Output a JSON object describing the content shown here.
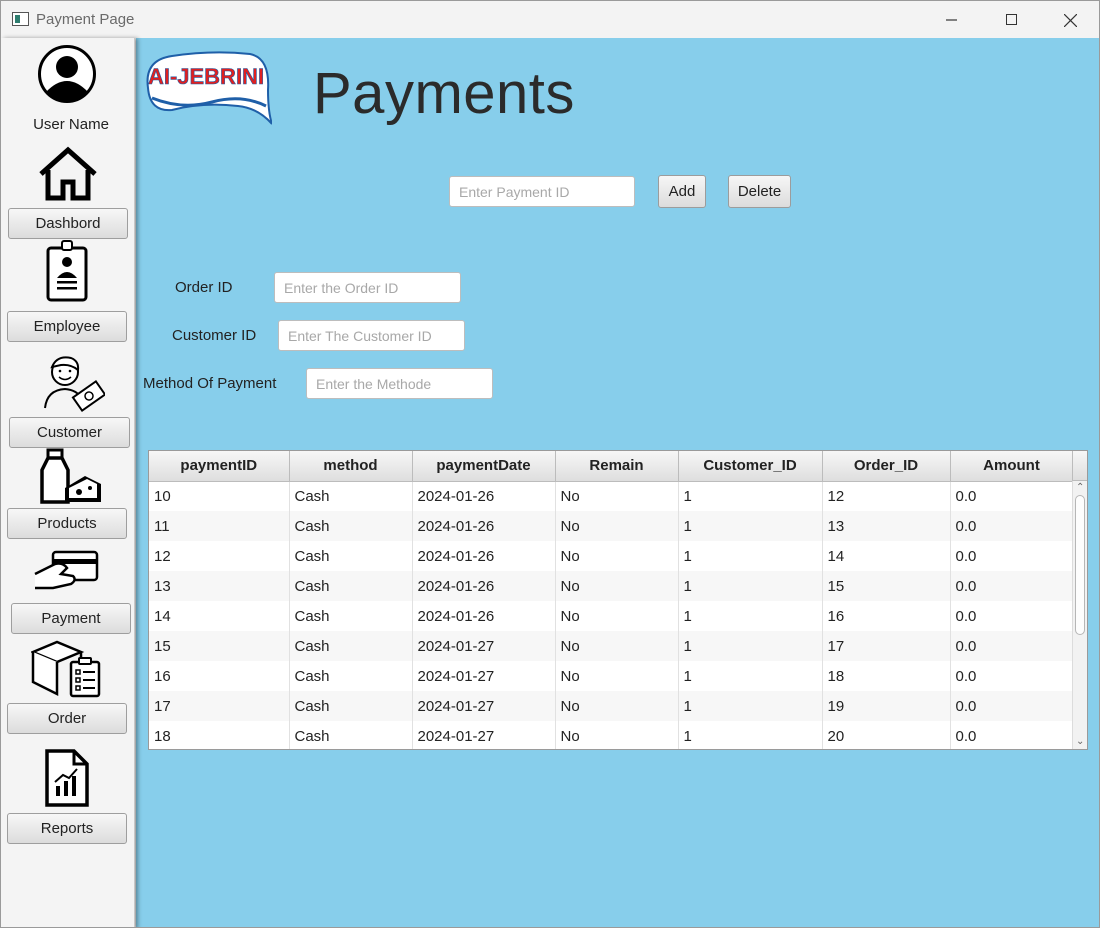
{
  "window": {
    "title": "Payment Page"
  },
  "sidebar": {
    "user_name": "User Name",
    "items": [
      {
        "label": "Dashbord",
        "icon": "home-icon"
      },
      {
        "label": "Employee",
        "icon": "employee-badge-icon"
      },
      {
        "label": "Customer",
        "icon": "customer-with-cash-icon"
      },
      {
        "label": "Products",
        "icon": "milk-and-cheese-icon"
      },
      {
        "label": "Payment",
        "icon": "card-payment-icon"
      },
      {
        "label": "Order",
        "icon": "box-checklist-icon"
      },
      {
        "label": "Reports",
        "icon": "report-chart-icon"
      }
    ]
  },
  "header": {
    "logo_text": "AI-JEBRINI",
    "title": "Payments"
  },
  "payment_id": {
    "placeholder": "Enter Payment ID",
    "add_label": "Add",
    "delete_label": "Delete"
  },
  "form": {
    "order_label": "Order ID",
    "order_placeholder": "Enter the Order ID",
    "customer_label": "Customer ID",
    "customer_placeholder": "Enter The Customer ID",
    "method_label": "Method Of Payment",
    "method_placeholder": "Enter the Methode"
  },
  "table": {
    "columns": [
      "paymentID",
      "method",
      "paymentDate",
      "Remain",
      "Customer_ID",
      "Order_ID",
      "Amount"
    ],
    "rows": [
      [
        "10",
        "Cash",
        "2024-01-26",
        "No",
        "1",
        "12",
        "0.0"
      ],
      [
        "11",
        "Cash",
        "2024-01-26",
        "No",
        "1",
        "13",
        "0.0"
      ],
      [
        "12",
        "Cash",
        "2024-01-26",
        "No",
        "1",
        "14",
        "0.0"
      ],
      [
        "13",
        "Cash",
        "2024-01-26",
        "No",
        "1",
        "15",
        "0.0"
      ],
      [
        "14",
        "Cash",
        "2024-01-26",
        "No",
        "1",
        "16",
        "0.0"
      ],
      [
        "15",
        "Cash",
        "2024-01-27",
        "No",
        "1",
        "17",
        "0.0"
      ],
      [
        "16",
        "Cash",
        "2024-01-27",
        "No",
        "1",
        "18",
        "0.0"
      ],
      [
        "17",
        "Cash",
        "2024-01-27",
        "No",
        "1",
        "19",
        "0.0"
      ],
      [
        "18",
        "Cash",
        "2024-01-27",
        "No",
        "1",
        "20",
        "0.0"
      ]
    ]
  },
  "colors": {
    "main_background": "#87ceeb",
    "logo_red": "#e02020",
    "logo_blue": "#1f5fa8"
  }
}
